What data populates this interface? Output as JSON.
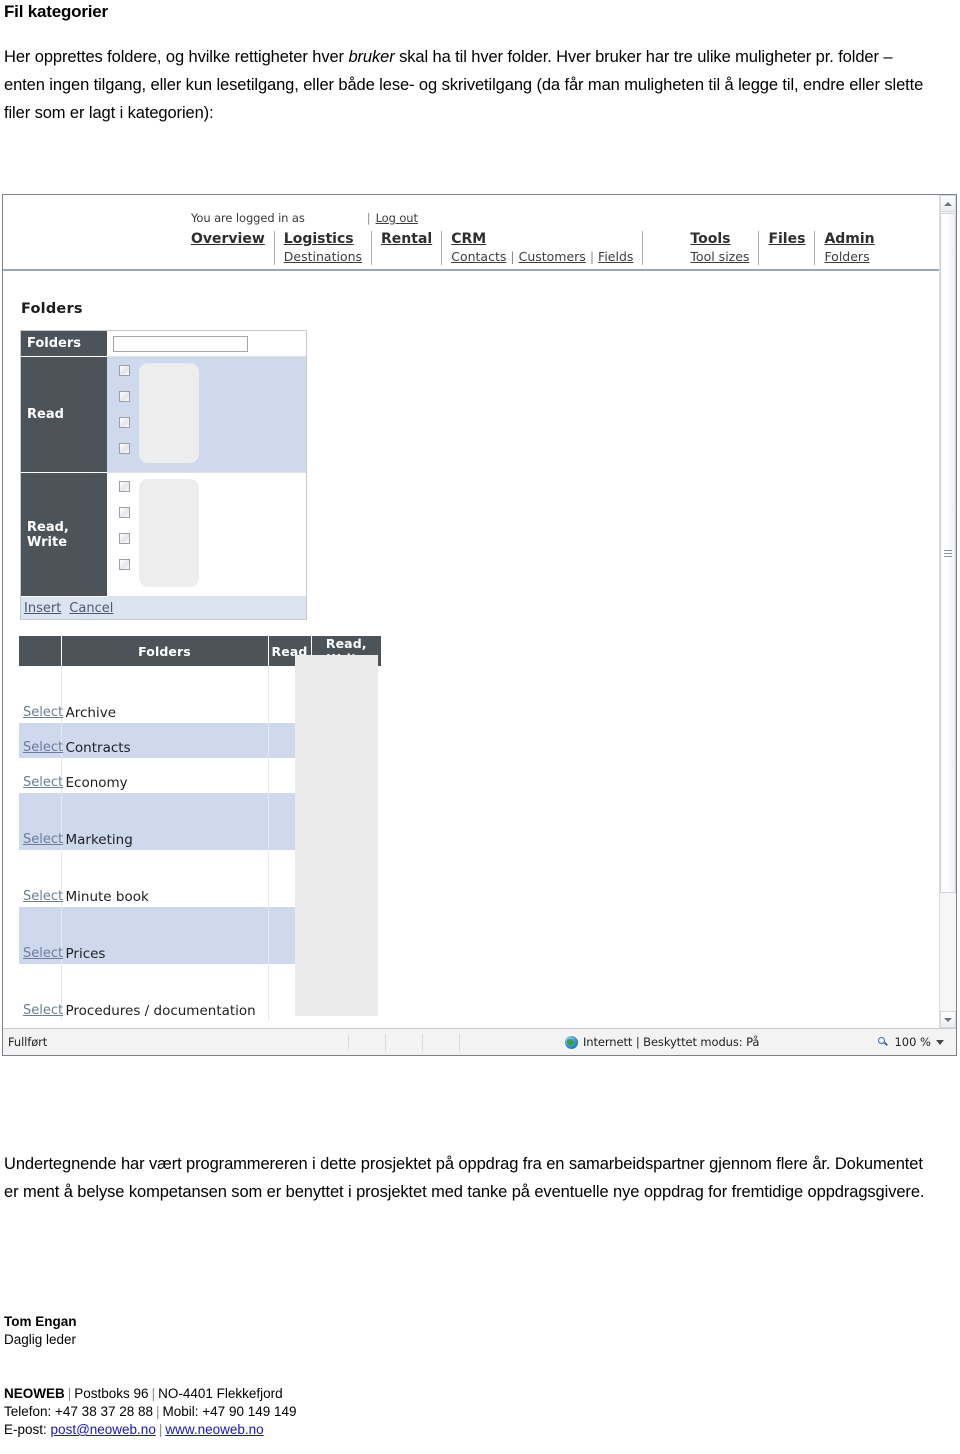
{
  "document": {
    "heading": "Fil kategorier",
    "intro_part1": "Her opprettes foldere, og hvilke rettigheter hver ",
    "intro_emphasis": "bruker",
    "intro_part2": " skal ha til hver folder. Hver bruker har tre ulike muligheter pr. folder – enten ingen tilgang, eller kun lesetilgang, eller både lese- og skrivetilgang (da får man muligheten til å legge til, endre eller slette filer som er lagt i kategorien):",
    "outro": "Undertegnende har vært programmereren i dette prosjektet på oppdrag fra en samarbeidspartner gjennom flere år. Dokumentet er ment å belyse kompetansen som er benyttet i prosjektet med tanke på eventuelle nye oppdrag for fremtidige oppdragsgivere."
  },
  "app": {
    "login": {
      "logged_in_label": "You are logged in as",
      "username": "",
      "separator": "|",
      "logout_label": "Log out"
    },
    "nav": [
      {
        "main": "Overview",
        "subs": []
      },
      {
        "main": "Logistics",
        "subs": [
          "Destinations"
        ]
      },
      {
        "main": "Rental",
        "subs": []
      },
      {
        "main": "CRM",
        "subs": [
          "Contacts",
          "Customers",
          "Fields"
        ]
      },
      {
        "main": "Tools",
        "subs": [
          "Tool sizes"
        ]
      },
      {
        "main": "Files",
        "subs": []
      },
      {
        "main": "Admin",
        "subs": [
          "Folders"
        ]
      }
    ],
    "page_title": "Folders",
    "form": {
      "folders_label": "Folders",
      "folders_value": "",
      "read_label": "Read",
      "readwrite_label": "Read, Write",
      "read_checkbox_count": 4,
      "readwrite_checkbox_count": 4,
      "insert_label": "Insert",
      "cancel_label": "Cancel"
    },
    "grid": {
      "columns": [
        "",
        "Folders",
        "Read",
        "Read, Write"
      ],
      "select_label": "Select",
      "rows": [
        {
          "name": "Archive",
          "read": "",
          "read_write": "",
          "tall": true
        },
        {
          "name": "Contracts",
          "read": "",
          "read_write": "",
          "tall": false
        },
        {
          "name": "Economy",
          "read": "",
          "read_write": "",
          "tall": false
        },
        {
          "name": "Marketing",
          "read": "",
          "read_write": "",
          "tall": true
        },
        {
          "name": "Minute book",
          "read": "",
          "read_write": "",
          "tall": true
        },
        {
          "name": "Prices",
          "read": "",
          "read_write": "",
          "tall": true
        },
        {
          "name": "Procedures / documentation",
          "read": "",
          "read_write": "",
          "tall": true
        }
      ]
    },
    "statusbar": {
      "status": "Fullført",
      "zone": "Internett | Beskyttet modus: På",
      "zoom": "100 %"
    }
  },
  "signature": {
    "name": "Tom Engan",
    "role": "Daglig leder",
    "company": "NEOWEB",
    "address_box": "Postboks 96",
    "address_city": "NO-4401 Flekkefjord",
    "phone": "Telefon: +47 38 37 28 88",
    "mobile": "Mobil: +47 90 149 149",
    "email_label": "E-post:",
    "email": "post@neoweb.no",
    "website": "www.neoweb.no"
  },
  "colors": {
    "header_dark": "#4c5359",
    "row_alt": "#ced9ee",
    "link": "#6b7d99",
    "mail_link": "#1414c8"
  }
}
